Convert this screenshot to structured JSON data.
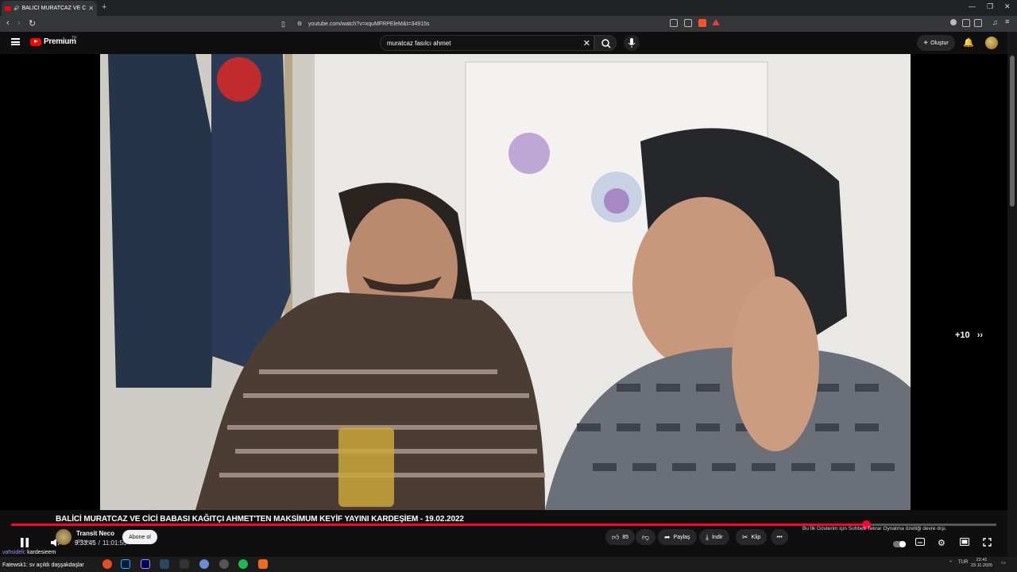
{
  "browser": {
    "tab_title": "BALICI MURATCAZ VE CİCİ BA",
    "url": "youtube.com/watch?v=xquMFRPEleM&t=34915s"
  },
  "header": {
    "logo_text": "Premium",
    "logo_region": "TR",
    "search_value": "muratcaz fasılcı ahmet",
    "create_label": "Oluştur"
  },
  "player": {
    "current_time": "9:33:45",
    "separator": "/",
    "duration": "11:01:55",
    "seek_label": "+10",
    "progress_fraction": 0.8676,
    "accent": "#ff0033"
  },
  "video": {
    "title": "BALİCİ MURATCAZ VE CİCİ BABASI KAĞITÇI AHMET'TEN MAKSİMUM KEYİF YAYINI KARDEŞİEM - 19.02.2022",
    "channel_name": "Transit Neco",
    "subscribers": "353 abone",
    "subscribe_label": "Abone ol",
    "likes": "85",
    "share_label": "Paylaş",
    "download_label": "İndir",
    "clip_label": "Klip"
  },
  "side_note": "Bu İlk Gösterim için Sohbeti Tekrar Oynatma özelliği devre dışı.",
  "chat": [
    {
      "user": "vahsideli",
      "message": "kardesieem"
    },
    {
      "user": "Fatewsk1",
      "message": "sv açıldı daşşakdaşlar"
    }
  ],
  "taskbar": {
    "lang": "TUR",
    "time": "22:41",
    "date": "23.11.2025"
  }
}
